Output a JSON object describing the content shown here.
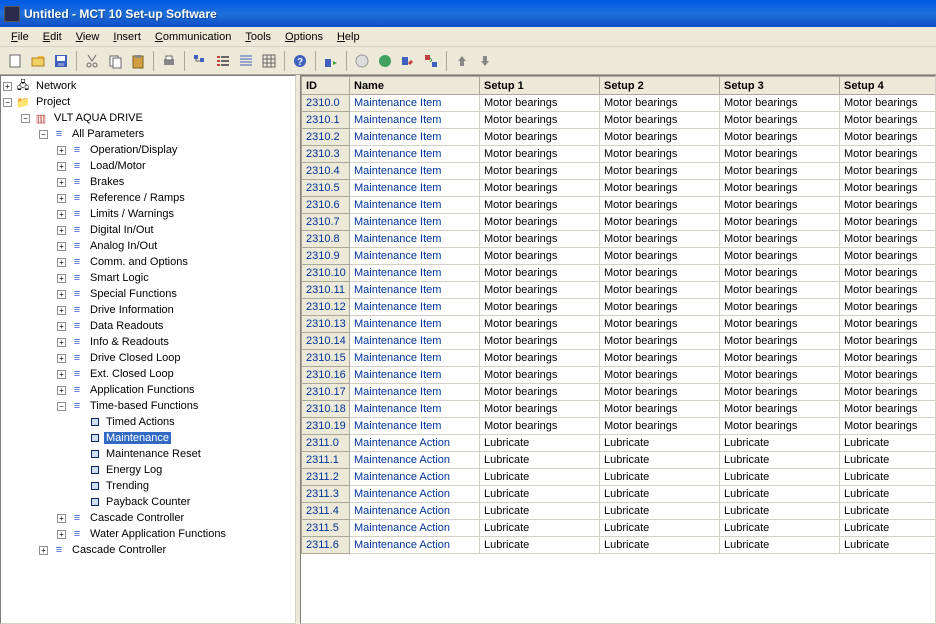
{
  "window": {
    "title": "Untitled - MCT 10 Set-up Software"
  },
  "menu": [
    "File",
    "Edit",
    "View",
    "Insert",
    "Communication",
    "Tools",
    "Options",
    "Help"
  ],
  "tree": {
    "network": "Network",
    "project": "Project",
    "drive": "VLT AQUA DRIVE",
    "allparams": "All Parameters",
    "params": [
      "Operation/Display",
      "Load/Motor",
      "Brakes",
      "Reference / Ramps",
      "Limits / Warnings",
      "Digital In/Out",
      "Analog In/Out",
      "Comm. and Options",
      "Smart Logic",
      "Special Functions",
      "Drive Information",
      "Data Readouts",
      "Info & Readouts",
      "Drive Closed Loop",
      "Ext. Closed Loop",
      "Application Functions",
      "Time-based Functions"
    ],
    "timebased": [
      "Timed Actions",
      "Maintenance",
      "Maintenance Reset",
      "Energy Log",
      "Trending",
      "Payback Counter"
    ],
    "selected": "Maintenance",
    "after": [
      "Cascade Controller",
      "Water Application Functions"
    ],
    "cascade": "Cascade Controller"
  },
  "grid": {
    "headers": [
      "ID",
      "Name",
      "Setup 1",
      "Setup 2",
      "Setup 3",
      "Setup 4"
    ],
    "rows": [
      {
        "id": "2310.0",
        "name": "Maintenance Item",
        "s1": "Motor bearings",
        "s2": "Motor bearings",
        "s3": "Motor bearings",
        "s4": "Motor bearings"
      },
      {
        "id": "2310.1",
        "name": "Maintenance Item",
        "s1": "Motor bearings",
        "s2": "Motor bearings",
        "s3": "Motor bearings",
        "s4": "Motor bearings"
      },
      {
        "id": "2310.2",
        "name": "Maintenance Item",
        "s1": "Motor bearings",
        "s2": "Motor bearings",
        "s3": "Motor bearings",
        "s4": "Motor bearings"
      },
      {
        "id": "2310.3",
        "name": "Maintenance Item",
        "s1": "Motor bearings",
        "s2": "Motor bearings",
        "s3": "Motor bearings",
        "s4": "Motor bearings"
      },
      {
        "id": "2310.4",
        "name": "Maintenance Item",
        "s1": "Motor bearings",
        "s2": "Motor bearings",
        "s3": "Motor bearings",
        "s4": "Motor bearings"
      },
      {
        "id": "2310.5",
        "name": "Maintenance Item",
        "s1": "Motor bearings",
        "s2": "Motor bearings",
        "s3": "Motor bearings",
        "s4": "Motor bearings"
      },
      {
        "id": "2310.6",
        "name": "Maintenance Item",
        "s1": "Motor bearings",
        "s2": "Motor bearings",
        "s3": "Motor bearings",
        "s4": "Motor bearings"
      },
      {
        "id": "2310.7",
        "name": "Maintenance Item",
        "s1": "Motor bearings",
        "s2": "Motor bearings",
        "s3": "Motor bearings",
        "s4": "Motor bearings"
      },
      {
        "id": "2310.8",
        "name": "Maintenance Item",
        "s1": "Motor bearings",
        "s2": "Motor bearings",
        "s3": "Motor bearings",
        "s4": "Motor bearings"
      },
      {
        "id": "2310.9",
        "name": "Maintenance Item",
        "s1": "Motor bearings",
        "s2": "Motor bearings",
        "s3": "Motor bearings",
        "s4": "Motor bearings"
      },
      {
        "id": "2310.10",
        "name": "Maintenance Item",
        "s1": "Motor bearings",
        "s2": "Motor bearings",
        "s3": "Motor bearings",
        "s4": "Motor bearings"
      },
      {
        "id": "2310.11",
        "name": "Maintenance Item",
        "s1": "Motor bearings",
        "s2": "Motor bearings",
        "s3": "Motor bearings",
        "s4": "Motor bearings"
      },
      {
        "id": "2310.12",
        "name": "Maintenance Item",
        "s1": "Motor bearings",
        "s2": "Motor bearings",
        "s3": "Motor bearings",
        "s4": "Motor bearings"
      },
      {
        "id": "2310.13",
        "name": "Maintenance Item",
        "s1": "Motor bearings",
        "s2": "Motor bearings",
        "s3": "Motor bearings",
        "s4": "Motor bearings"
      },
      {
        "id": "2310.14",
        "name": "Maintenance Item",
        "s1": "Motor bearings",
        "s2": "Motor bearings",
        "s3": "Motor bearings",
        "s4": "Motor bearings"
      },
      {
        "id": "2310.15",
        "name": "Maintenance Item",
        "s1": "Motor bearings",
        "s2": "Motor bearings",
        "s3": "Motor bearings",
        "s4": "Motor bearings"
      },
      {
        "id": "2310.16",
        "name": "Maintenance Item",
        "s1": "Motor bearings",
        "s2": "Motor bearings",
        "s3": "Motor bearings",
        "s4": "Motor bearings"
      },
      {
        "id": "2310.17",
        "name": "Maintenance Item",
        "s1": "Motor bearings",
        "s2": "Motor bearings",
        "s3": "Motor bearings",
        "s4": "Motor bearings"
      },
      {
        "id": "2310.18",
        "name": "Maintenance Item",
        "s1": "Motor bearings",
        "s2": "Motor bearings",
        "s3": "Motor bearings",
        "s4": "Motor bearings"
      },
      {
        "id": "2310.19",
        "name": "Maintenance Item",
        "s1": "Motor bearings",
        "s2": "Motor bearings",
        "s3": "Motor bearings",
        "s4": "Motor bearings"
      },
      {
        "id": "2311.0",
        "name": "Maintenance Action",
        "s1": "Lubricate",
        "s2": "Lubricate",
        "s3": "Lubricate",
        "s4": "Lubricate"
      },
      {
        "id": "2311.1",
        "name": "Maintenance Action",
        "s1": "Lubricate",
        "s2": "Lubricate",
        "s3": "Lubricate",
        "s4": "Lubricate"
      },
      {
        "id": "2311.2",
        "name": "Maintenance Action",
        "s1": "Lubricate",
        "s2": "Lubricate",
        "s3": "Lubricate",
        "s4": "Lubricate"
      },
      {
        "id": "2311.3",
        "name": "Maintenance Action",
        "s1": "Lubricate",
        "s2": "Lubricate",
        "s3": "Lubricate",
        "s4": "Lubricate"
      },
      {
        "id": "2311.4",
        "name": "Maintenance Action",
        "s1": "Lubricate",
        "s2": "Lubricate",
        "s3": "Lubricate",
        "s4": "Lubricate"
      },
      {
        "id": "2311.5",
        "name": "Maintenance Action",
        "s1": "Lubricate",
        "s2": "Lubricate",
        "s3": "Lubricate",
        "s4": "Lubricate"
      },
      {
        "id": "2311.6",
        "name": "Maintenance Action",
        "s1": "Lubricate",
        "s2": "Lubricate",
        "s3": "Lubricate",
        "s4": "Lubricate"
      }
    ]
  }
}
